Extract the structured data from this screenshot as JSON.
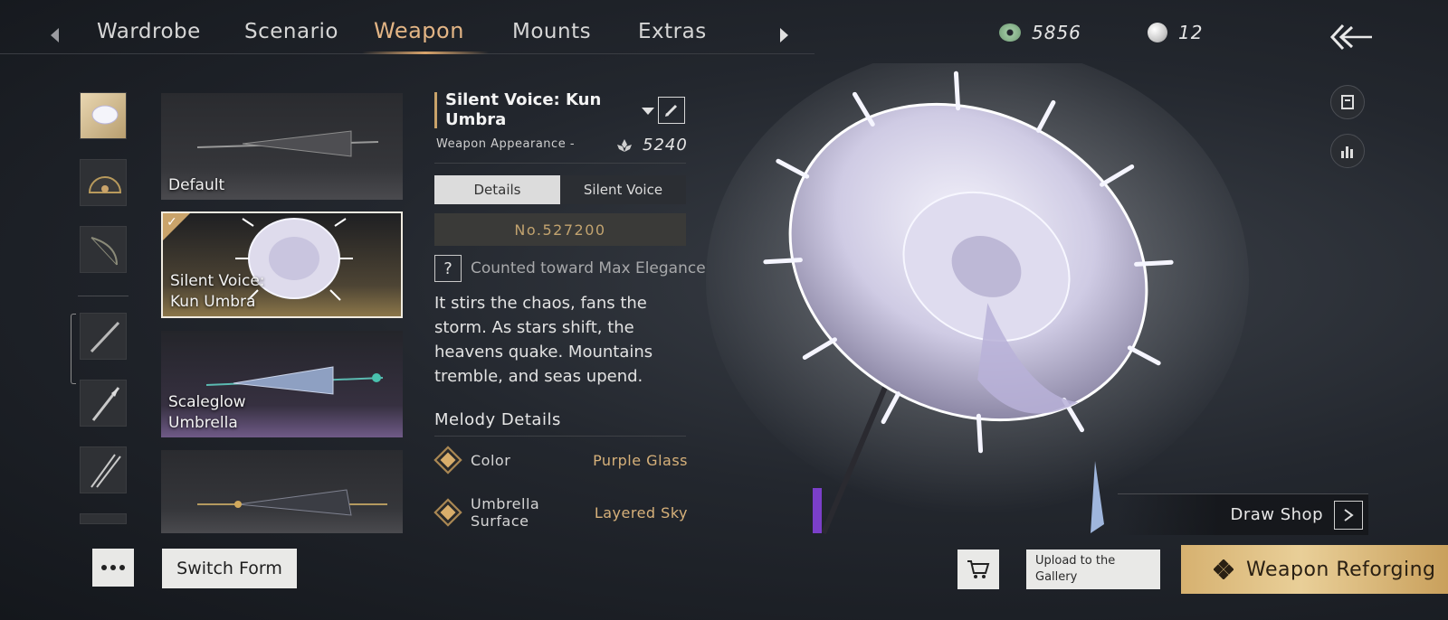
{
  "tabs": {
    "items": [
      {
        "label": "Wardrobe",
        "active": false
      },
      {
        "label": "Scenario",
        "active": false
      },
      {
        "label": "Weapon",
        "active": true
      },
      {
        "label": "Mounts",
        "active": false
      },
      {
        "label": "Extras",
        "active": false
      }
    ]
  },
  "currencies": {
    "jade": "5856",
    "pearl": "12"
  },
  "weapon_list": {
    "cards": [
      {
        "label": "Default",
        "selected": false
      },
      {
        "label": "Silent Voice:\nKun Umbra",
        "selected": true
      },
      {
        "label": "Scaleglow\nUmbrella",
        "selected": false
      },
      {
        "label": "",
        "selected": false
      }
    ]
  },
  "details": {
    "title": "Silent Voice: Kun Umbra",
    "subtitle": "Weapon Appearance -",
    "score": "5240",
    "segments": [
      "Details",
      "Silent Voice"
    ],
    "active_segment": "Details",
    "serial": "No.527200",
    "counted": "Counted toward Max Elegance",
    "description": "It stirs the chaos, fans the storm. As stars shift, the heavens quake. Mountains tremble, and seas upend.",
    "melody_heading": "Melody Details",
    "attributes": [
      {
        "key": "Color",
        "value": "Purple Glass"
      },
      {
        "key": "Umbrella Surface",
        "value": "Layered Sky"
      }
    ]
  },
  "actions": {
    "draw_shop": "Draw Shop",
    "switch_form": "Switch Form",
    "upload": "Upload to the Gallery",
    "reforge": "Weapon Reforging"
  },
  "colors": {
    "accent_gold": "#e3b585",
    "value_gold": "#d7b17a",
    "background": "#1c1f24"
  }
}
